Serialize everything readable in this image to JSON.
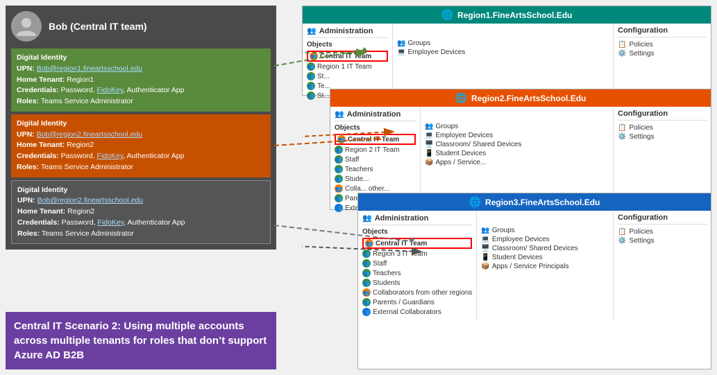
{
  "bob": {
    "name": "Bob (Central IT team)",
    "identities": [
      {
        "theme": "green",
        "upn": "Bob@region1.fineartsschool.edu",
        "homeTenant": "Region1",
        "credentials": "Password, FidoKey, Authenticator App",
        "roles": "Teams Service Administrator"
      },
      {
        "theme": "orange",
        "upn": "Bob@region2.fineartsschool.edu",
        "homeTenant": "Region2",
        "credentials": "Password, FidoKey, Authenticator App",
        "roles": "Teams Service Administrator"
      },
      {
        "theme": "dark",
        "upn": "Bob@region2.fineartsschool.edu",
        "homeTenant": "Region2",
        "credentials": "Password, FidoKey, Authenticator App",
        "roles": "Teams Service Administrator"
      }
    ]
  },
  "scenario": {
    "text": "Central IT Scenario 2: Using multiple accounts across multiple tenants for roles that don’t support Azure AD B2B"
  },
  "regions": [
    {
      "id": "region1",
      "name": "Region1.FineArtsSchool.Edu",
      "headerTheme": "teal",
      "adminLabel": "Administration",
      "configLabel": "Configuration",
      "objects": [
        "Central IT Team",
        "Region 1 IT Team",
        "St...",
        "Te...",
        "St..."
      ],
      "highlightedObject": "Central IT Team",
      "devices": [
        "Groups",
        "Employee Devices"
      ],
      "configItems": [
        "Policies",
        "Settings"
      ]
    },
    {
      "id": "region2",
      "name": "Region2.FineArtsSchool.Edu",
      "headerTheme": "orange",
      "adminLabel": "Administration",
      "configLabel": "Configuration",
      "objects": [
        "Central IT Team",
        "Region 2 IT Team",
        "Staff",
        "Teachers",
        "Stude...",
        "Colla... other...",
        "Pare...",
        "Exte..."
      ],
      "highlightedObject": "Central IT Team",
      "devices": [
        "Groups",
        "Employee Devices",
        "Classroom/ Shared Devices",
        "Student Devices",
        "Apps / Service..."
      ],
      "configItems": [
        "Policies",
        "Settings"
      ]
    },
    {
      "id": "region3",
      "name": "Region3.FineArtsSchool.Edu",
      "headerTheme": "blue",
      "adminLabel": "Administration",
      "configLabel": "Configuration",
      "objects": [
        "Central IT Team",
        "Region 3 IT Team",
        "Staff",
        "Teachers",
        "Students",
        "Collaborators from other regions",
        "Parents / Guardians",
        "External Collaborators"
      ],
      "highlightedObject": "Central IT Team",
      "devices": [
        "Groups",
        "Employee Devices",
        "Classroom/ Shared Devices",
        "Student Devices",
        "Apps / Service Principals"
      ],
      "configItems": [
        "Policies",
        "Settings"
      ]
    }
  ]
}
